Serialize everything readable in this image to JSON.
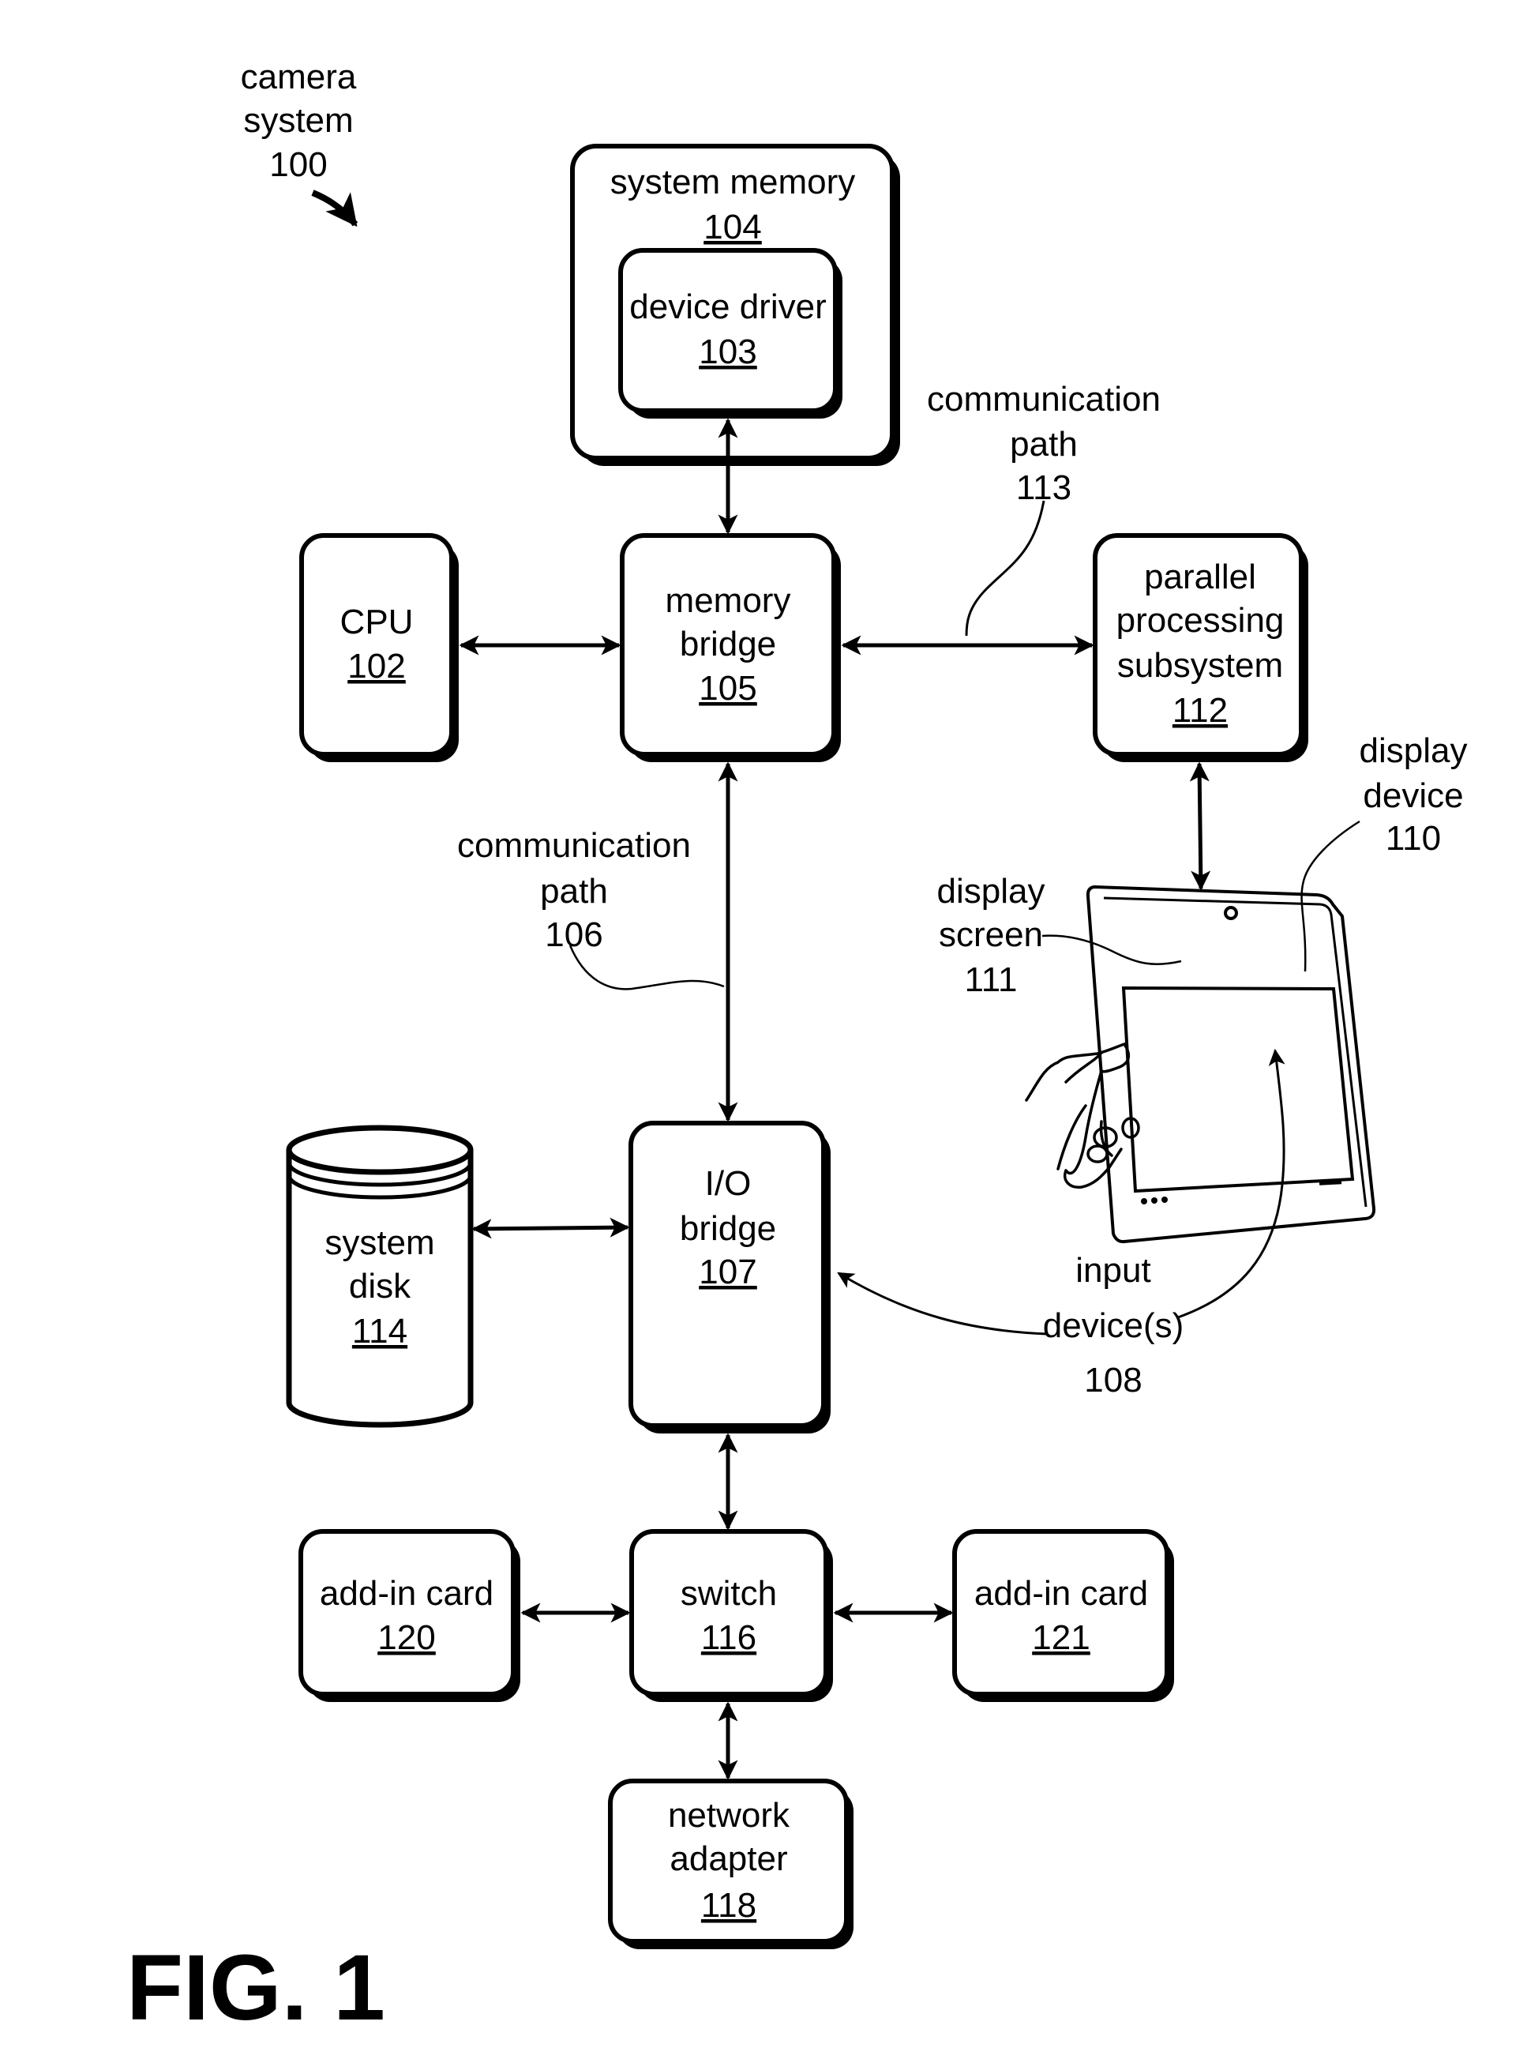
{
  "figure": {
    "title": "FIG. 1",
    "system_label": [
      "camera",
      "system",
      "100"
    ]
  },
  "components": {
    "system_memory": {
      "lines": [
        "system memory"
      ],
      "ref": "104"
    },
    "device_driver": {
      "lines": [
        "device driver"
      ],
      "ref": "103"
    },
    "cpu": {
      "lines": [
        "CPU"
      ],
      "ref": "102"
    },
    "memory_bridge": {
      "lines": [
        "memory",
        "bridge"
      ],
      "ref": "105"
    },
    "parallel_processing": {
      "lines": [
        "parallel",
        "processing",
        "subsystem"
      ],
      "ref": "112"
    },
    "io_bridge": {
      "lines": [
        "I/O",
        "bridge"
      ],
      "ref": "107"
    },
    "system_disk": {
      "lines": [
        "system",
        "disk"
      ],
      "ref": "114"
    },
    "add_in_card_left": {
      "lines": [
        "add-in card"
      ],
      "ref": "120"
    },
    "switch": {
      "lines": [
        "switch"
      ],
      "ref": "116"
    },
    "add_in_card_right": {
      "lines": [
        "add-in card"
      ],
      "ref": "121"
    },
    "network_adapter": {
      "lines": [
        "network",
        "adapter"
      ],
      "ref": "118"
    }
  },
  "callouts": {
    "comm_path_113": [
      "communication",
      "path",
      "113"
    ],
    "comm_path_106": [
      "communication",
      "path",
      "106"
    ],
    "display_device": [
      "display",
      "device",
      "110"
    ],
    "display_screen": [
      "display",
      "screen",
      "111"
    ],
    "input_devices": [
      "input",
      "device(s)",
      "108"
    ]
  }
}
